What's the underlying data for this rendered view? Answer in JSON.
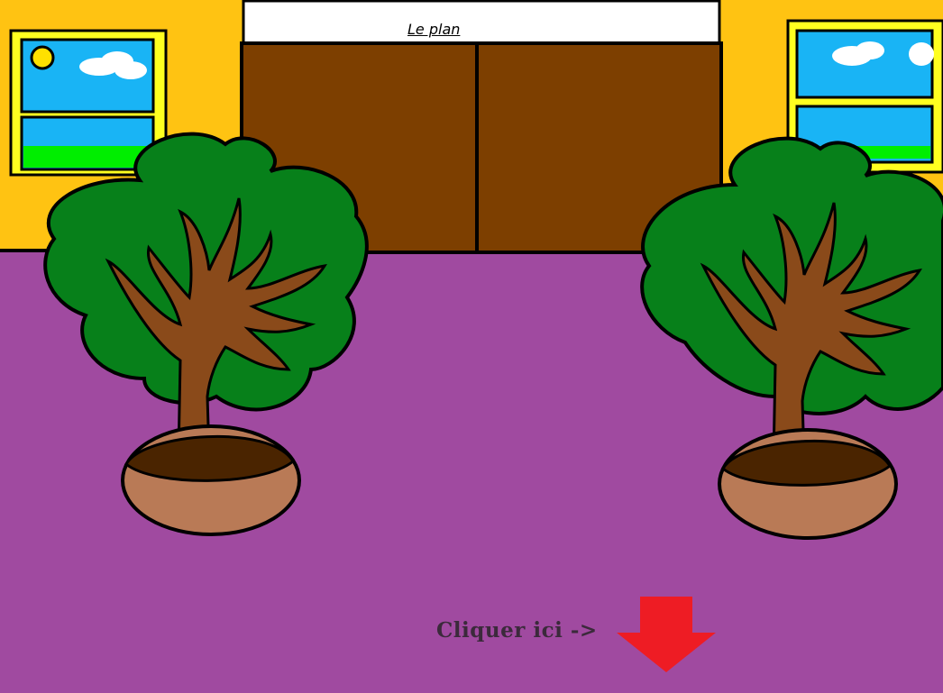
{
  "scene": {
    "sign_text": "Le plan",
    "hint_text": "Cliquer ici  ->"
  },
  "icons": {
    "next": "arrow-down-icon"
  },
  "colors": {
    "wall": "#ffc312",
    "floor": "#a04aa0",
    "door": "#7d3f00",
    "sky": "#19b4f5",
    "grass": "#00ee00",
    "foliage": "#07801a",
    "trunk": "#8a4a1a",
    "pot": "#b97a56",
    "arrow": "#ee1c24"
  }
}
